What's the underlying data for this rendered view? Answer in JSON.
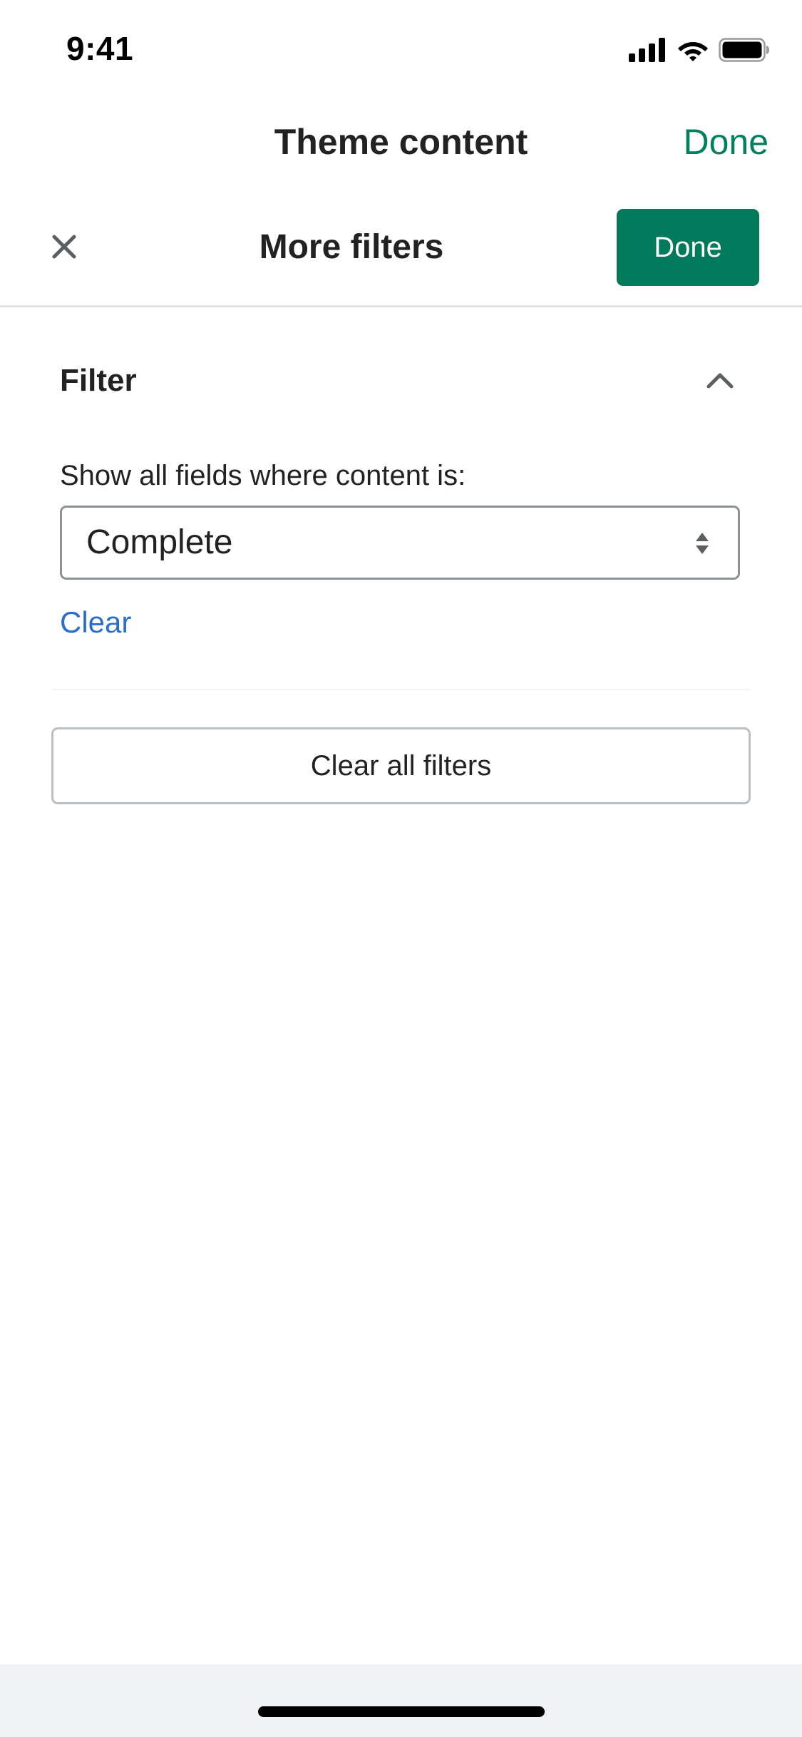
{
  "status_bar": {
    "time": "9:41",
    "icons": [
      "cellular-signal-icon",
      "wifi-icon",
      "battery-icon"
    ]
  },
  "nav": {
    "title": "Theme content",
    "done_label": "Done"
  },
  "modal": {
    "title": "More filters",
    "close_icon": "close-icon",
    "done_label": "Done"
  },
  "filter": {
    "section_title": "Filter",
    "collapse_icon": "chevron-up-icon",
    "label": "Show all fields where content is:",
    "select_value": "Complete",
    "select_icon": "select-arrows-icon",
    "clear_label": "Clear"
  },
  "clear_all_label": "Clear all filters",
  "colors": {
    "primary": "#007a5a",
    "nav_done": "#008060",
    "link": "#2c6ecb",
    "text": "#202223",
    "icon": "#5c5f62"
  }
}
